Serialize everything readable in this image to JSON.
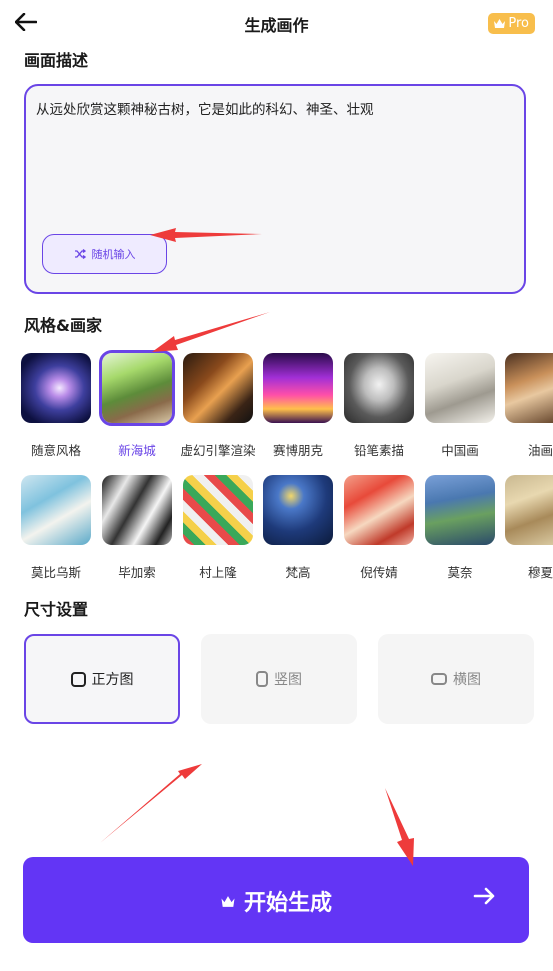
{
  "header": {
    "title": "生成画作",
    "pro_label": "Pro"
  },
  "description": {
    "section_title": "画面描述",
    "text": "从远处欣赏这颗神秘古树，它是如此的科幻、神圣、壮观",
    "random_button": "随机输入"
  },
  "styles": {
    "section_title": "风格&画家",
    "row1": [
      "随意风格",
      "新海城",
      "虚幻引擎渲染",
      "赛博朋克",
      "铅笔素描",
      "中国画",
      "油画"
    ],
    "row2": [
      "莫比乌斯",
      "毕加索",
      "村上隆",
      "梵高",
      "倪传婧",
      "莫奈",
      "穆夏"
    ],
    "selected": "新海城"
  },
  "size": {
    "section_title": "尺寸设置",
    "options": [
      "正方图",
      "竖图",
      "横图"
    ],
    "selected": "正方图"
  },
  "start_button": {
    "label": "开始生成"
  },
  "colors": {
    "accent": "#6335f5",
    "selection": "#6a45e6",
    "pro": "#f8be4c",
    "annotation_arrow": "#ee3b3b"
  }
}
